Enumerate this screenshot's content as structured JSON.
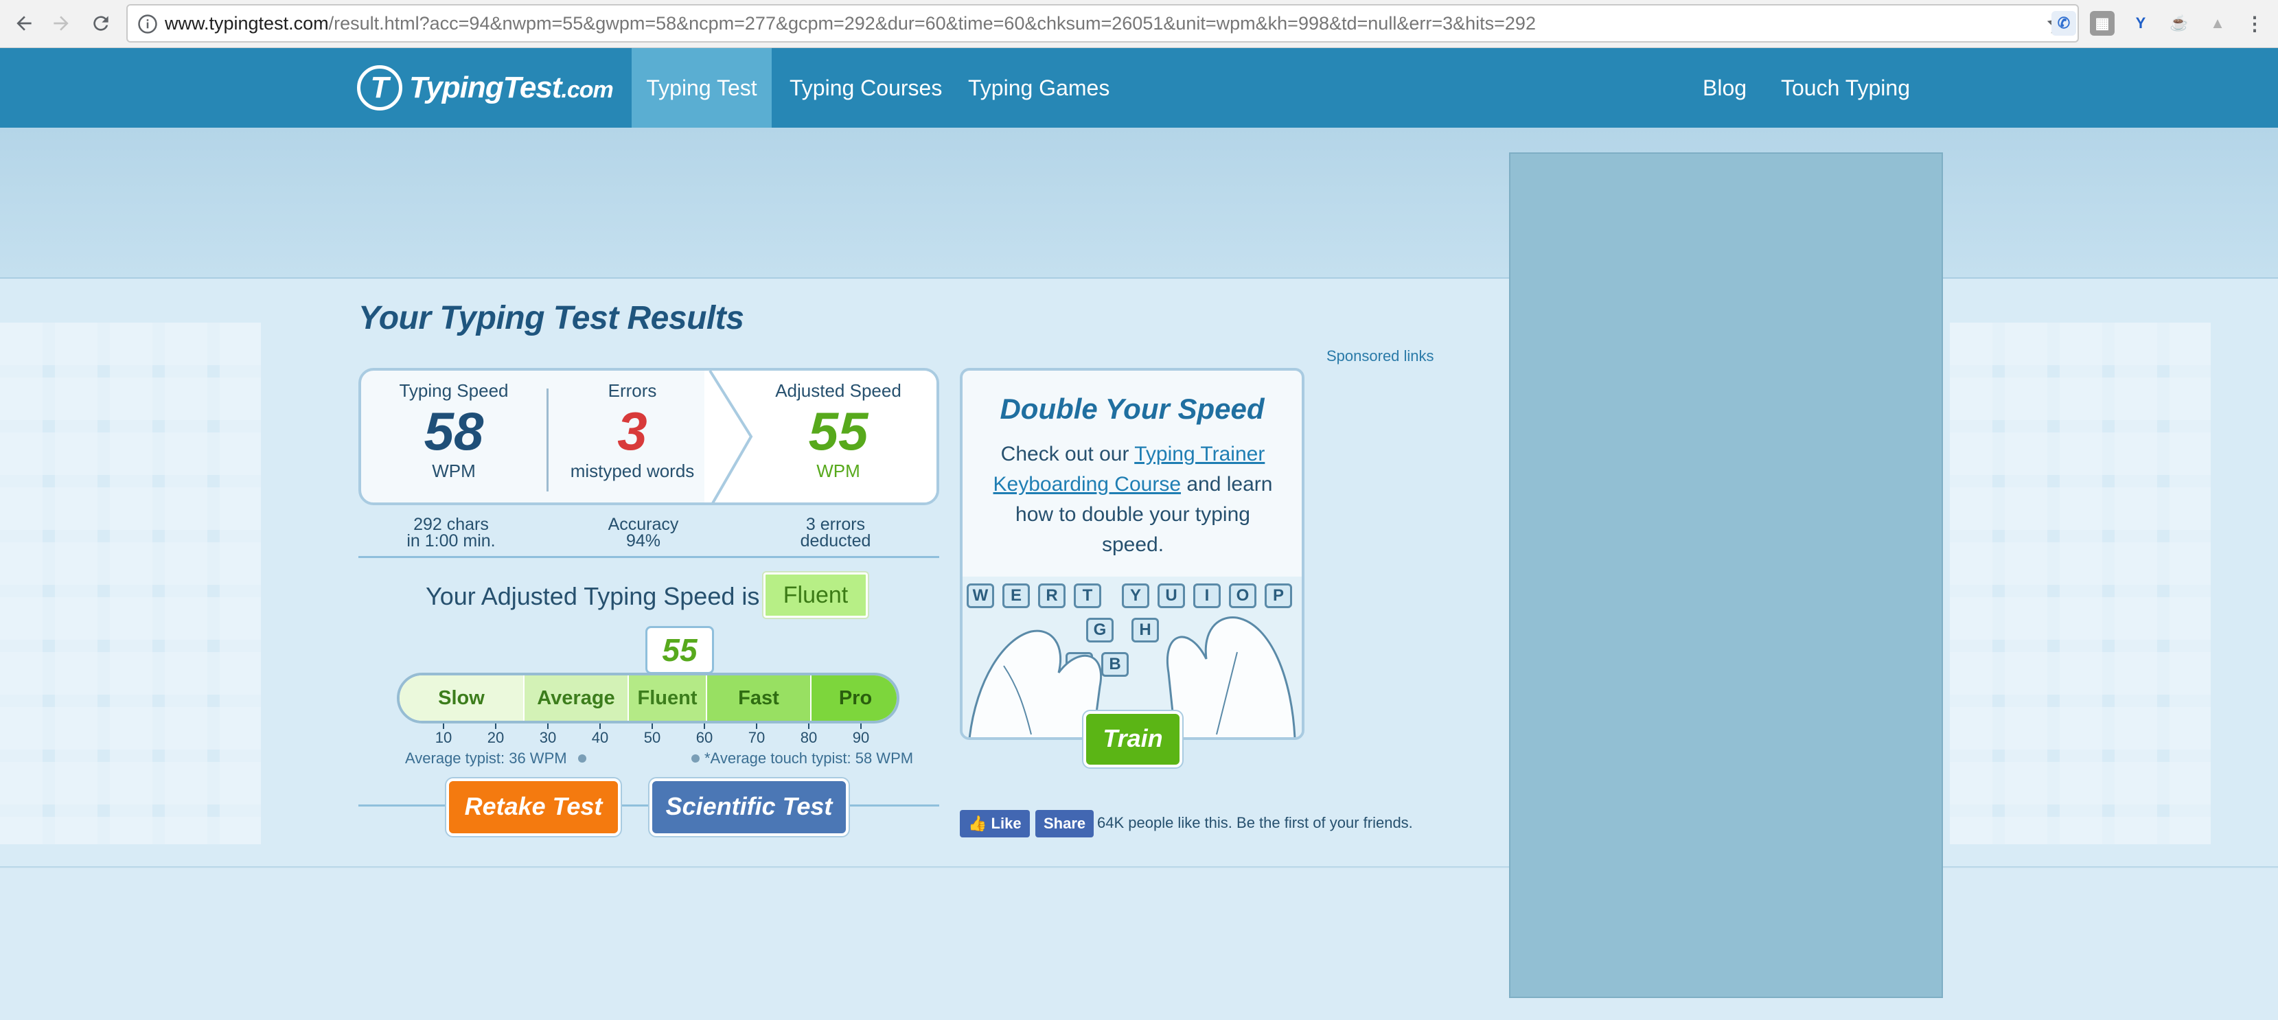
{
  "browser": {
    "url_host": "www.typingtest.com",
    "url_path": "/result.html?acc=94&nwpm=55&gwpm=58&ncpm=277&gcpm=292&dur=60&time=60&chksum=26051&unit=wpm&kh=998&td=null&err=3&hits=292",
    "icons": [
      "back-icon",
      "forward-icon",
      "reload-icon",
      "info-icon",
      "star-icon"
    ]
  },
  "nav": {
    "logo_main": "TypingTest",
    "logo_suffix": ".com",
    "links": [
      "Typing Test",
      "Typing Courses",
      "Typing Games",
      "Blog",
      "Touch Typing"
    ],
    "active": "Typing Test"
  },
  "results": {
    "title": "Your Typing Test Results",
    "sponsored": "Sponsored links",
    "typing_speed": {
      "label": "Typing Speed",
      "value": "58",
      "unit": "WPM",
      "sub1": "292 chars",
      "sub2": "in 1:00 min."
    },
    "errors": {
      "label": "Errors",
      "value": "3",
      "unit": "mistyped words",
      "sub1": "Accuracy",
      "sub2": "94%"
    },
    "adjusted": {
      "label": "Adjusted Speed",
      "value": "55",
      "unit": "WPM",
      "sub1": "3 errors",
      "sub2": "deducted"
    },
    "adjusted_line": "Your Adjusted Typing Speed is",
    "level": "Fluent",
    "bubble_value": "55",
    "scale_segments": [
      "Slow",
      "Average",
      "Fluent",
      "Fast",
      "Pro"
    ],
    "scale_ticks": [
      "10",
      "20",
      "30",
      "40",
      "50",
      "60",
      "70",
      "80",
      "90"
    ],
    "avg_typist": "Average typist: 36 WPM",
    "avg_touch": "*Average touch typist: 58 WPM",
    "retake_button": "Retake Test",
    "scientific_button": "Scientific Test"
  },
  "promo": {
    "title": "Double Your Speed",
    "text_before": "Check out our ",
    "link": "Typing Trainer Keyboarding Course",
    "text_after": " and learn how to double your typing speed.",
    "keys_row1": [
      "W",
      "E",
      "R",
      "T",
      "Y",
      "U",
      "I",
      "O",
      "P"
    ],
    "keys_row2": [
      "G",
      "H"
    ],
    "keys_row3": [
      "V",
      "B"
    ],
    "train_button": "Train"
  },
  "social": {
    "like": "Like",
    "share": "Share",
    "text": "64K people like this. Be the first of your friends."
  },
  "colors": {
    "nav_bg": "#2787b5",
    "nav_active": "#5aaed2",
    "speed_color": "#1f4f78",
    "error_color": "#d83a3a",
    "adjusted_color": "#57a91c",
    "retake_bg": "#f47a0f",
    "scientific_bg": "#4b77b5",
    "train_bg": "#5bb515"
  }
}
